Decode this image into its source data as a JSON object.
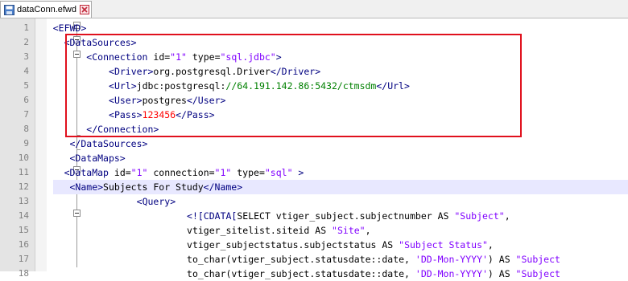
{
  "tab": {
    "filename": "dataConn.efwd"
  },
  "colors": {
    "tag": "#000080",
    "attribute": "#000000",
    "string": "#8000ff",
    "url_text": "#008000",
    "number_text": "#ff0000",
    "highlight_box": "#e0101d",
    "current_line": "#e8e8ff"
  },
  "icons": {
    "tab": "file-icon",
    "close": "close-icon"
  },
  "current_line": 12,
  "lines": [
    {
      "n": "1",
      "indent": 4,
      "parts": [
        [
          "tag",
          "<EFWD>"
        ]
      ]
    },
    {
      "n": "2",
      "indent": 6,
      "parts": [
        [
          "tag",
          "<DataSources>"
        ]
      ]
    },
    {
      "n": "3",
      "indent": 10,
      "parts": [
        [
          "tag",
          "<Connection "
        ],
        [
          "attr",
          "id="
        ],
        [
          "str",
          "\"1\""
        ],
        [
          "attr",
          " type="
        ],
        [
          "str",
          "\"sql.jdbc\""
        ],
        [
          "tag",
          ">"
        ]
      ]
    },
    {
      "n": "4",
      "indent": 14,
      "parts": [
        [
          "tag",
          "<Driver>"
        ],
        [
          "txt",
          "org.postgresql.Driver"
        ],
        [
          "tag",
          "</Driver>"
        ]
      ]
    },
    {
      "n": "5",
      "indent": 14,
      "parts": [
        [
          "tag",
          "<Url>"
        ],
        [
          "txt",
          "jdbc:postgresql:"
        ],
        [
          "url",
          "//64.191.142.86:5432/ctmsdm"
        ],
        [
          "tag",
          "</Url>"
        ]
      ]
    },
    {
      "n": "6",
      "indent": 14,
      "parts": [
        [
          "tag",
          "<User>"
        ],
        [
          "txt",
          "postgres"
        ],
        [
          "tag",
          "</User>"
        ]
      ]
    },
    {
      "n": "7",
      "indent": 14,
      "parts": [
        [
          "tag",
          "<Pass>"
        ],
        [
          "num",
          "123456"
        ],
        [
          "tag",
          "</Pass>"
        ]
      ]
    },
    {
      "n": "8",
      "indent": 10,
      "parts": [
        [
          "tag",
          "</Connection>"
        ]
      ]
    },
    {
      "n": "9",
      "indent": 7,
      "parts": [
        [
          "tag",
          "</DataSources>"
        ]
      ]
    },
    {
      "n": "10",
      "indent": 7,
      "parts": [
        [
          "tag",
          "<DataMaps>"
        ]
      ]
    },
    {
      "n": "11",
      "indent": 6,
      "parts": [
        [
          "tag",
          "<DataMap "
        ],
        [
          "attr",
          "id="
        ],
        [
          "str",
          "\"1\""
        ],
        [
          "attr",
          " connection="
        ],
        [
          "str",
          "\"1\""
        ],
        [
          "attr",
          " type="
        ],
        [
          "str",
          "\"sql\""
        ],
        [
          "tag",
          " >"
        ]
      ]
    },
    {
      "n": "12",
      "indent": 7,
      "parts": [
        [
          "tag",
          "<Name>"
        ],
        [
          "txt",
          "Subjects For Study"
        ],
        [
          "tag",
          "</Name>"
        ]
      ]
    },
    {
      "n": "13",
      "indent": 19,
      "parts": [
        [
          "tag",
          "<Query>"
        ]
      ]
    },
    {
      "n": "14",
      "indent": 28,
      "parts": [
        [
          "tag",
          "<![CDATA["
        ],
        [
          "txt",
          "SELECT vtiger_subject.subjectnumber AS "
        ],
        [
          "str",
          "\"Subject\""
        ],
        [
          "txt",
          ","
        ]
      ]
    },
    {
      "n": "15",
      "indent": 28,
      "parts": [
        [
          "txt",
          "vtiger_sitelist.siteid AS "
        ],
        [
          "str",
          "\"Site\""
        ],
        [
          "txt",
          ","
        ]
      ]
    },
    {
      "n": "16",
      "indent": 28,
      "parts": [
        [
          "txt",
          "vtiger_subjectstatus.subjectstatus AS "
        ],
        [
          "str",
          "\"Subject Status\""
        ],
        [
          "txt",
          ","
        ]
      ]
    },
    {
      "n": "17",
      "indent": 28,
      "parts": [
        [
          "txt",
          "to_char(vtiger_subject.statusdate::date, "
        ],
        [
          "str",
          "'DD-Mon-YYYY'"
        ],
        [
          "txt",
          ") AS "
        ],
        [
          "str",
          "\"Subject"
        ]
      ]
    },
    {
      "n": "18",
      "indent": 28,
      "parts": [
        [
          "txt",
          "to_char(vtiger_subject.statusdate::date, "
        ],
        [
          "str",
          "'DD-Mon-YYYY'"
        ],
        [
          "txt",
          ") AS "
        ],
        [
          "str",
          "\"Subject"
        ]
      ]
    }
  ]
}
